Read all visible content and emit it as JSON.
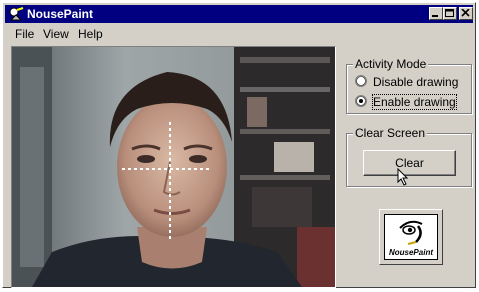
{
  "window": {
    "title": "NousePaint"
  },
  "menu": {
    "items": [
      "File",
      "View",
      "Help"
    ]
  },
  "activity_mode": {
    "label": "Activity Mode",
    "options": [
      "Disable drawing",
      "Enable drawing"
    ],
    "selected": "Enable drawing"
  },
  "clear_screen": {
    "label": "Clear Screen",
    "button_label": "Clear"
  },
  "logo": {
    "text": "NousePaint"
  },
  "colors": {
    "titlebar": "#000080",
    "face": "#d4d0c8"
  }
}
